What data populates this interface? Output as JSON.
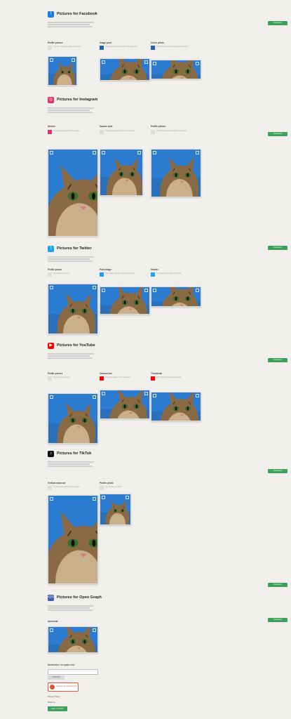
{
  "colors": {
    "background": "#f1efeb",
    "accent_green": "#3ea05a",
    "facebook": "#1877f2",
    "instagram": "#e1306c",
    "twitter": "#1da1f2",
    "youtube": "#ff0000",
    "tiktok": "#111111",
    "opengraph": "#4a5fb0"
  },
  "sections": {
    "facebook": {
      "title": "Pictures for Facebook",
      "icon": "facebook-icon",
      "button": "Download",
      "items": [
        {
          "label": "Profile picture",
          "hint": "Tip: Try to keep the subject centered"
        },
        {
          "label": "Image post",
          "hint": "Tip: Keep important details in the safe area"
        },
        {
          "label": "Cover photo",
          "hint": "Tip: Profile picture overlaps the bottom left"
        }
      ]
    },
    "instagram": {
      "title": "Pictures for Instagram",
      "icon": "instagram-icon",
      "button": "Download",
      "items": [
        {
          "label": "Stories",
          "hint": "Tip: Keep text away from the edges"
        },
        {
          "label": "Square post",
          "hint": "Tip: Square posts are shown in the feed"
        },
        {
          "label": "Profile picture",
          "hint": "Tip: Profile pictures are shown as circles"
        }
      ]
    },
    "twitter": {
      "title": "Pictures for Twitter",
      "icon": "twitter-icon",
      "button": "Download",
      "items": [
        {
          "label": "Profile photo",
          "hint": "Tip: Shown as a circle"
        },
        {
          "label": "Post image",
          "hint": "Tip: Images may be cropped in the feed"
        },
        {
          "label": "Header",
          "hint": "Tip: Header is cropped on mobile"
        }
      ]
    },
    "youtube": {
      "title": "Pictures for YouTube",
      "icon": "youtube-icon",
      "button": "Download",
      "items": [
        {
          "label": "Profile picture",
          "hint": "Tip: Shown as a circle"
        },
        {
          "label": "Channel art",
          "hint": "Tip: Keep content in the safe area"
        },
        {
          "label": "Thumbnail",
          "hint": "Tip: Thumbnails are shown small"
        }
      ]
    },
    "tiktok": {
      "title": "Pictures for TikTok",
      "icon": "tiktok-icon",
      "button": "Download",
      "items": [
        {
          "label": "Vertical video ad",
          "hint": "Tip: Keep text away from the edges"
        },
        {
          "label": "Profile photo",
          "hint": "Tip: Shown as a circle"
        }
      ]
    },
    "opengraph": {
      "title": "Pictures for Open Graph",
      "icon": "code-icon",
      "button": "Download",
      "items": [
        {
          "label": "Universal"
        }
      ]
    }
  },
  "footer": {
    "newsletter": "Newsletter: no spam ever",
    "email_placeholder": "Email address",
    "subscribe": "Subscribe",
    "producthunt": "Featured on Product Hunt",
    "privacy": "Privacy Policy",
    "made_by": "Made by",
    "button": "Give us credits"
  }
}
